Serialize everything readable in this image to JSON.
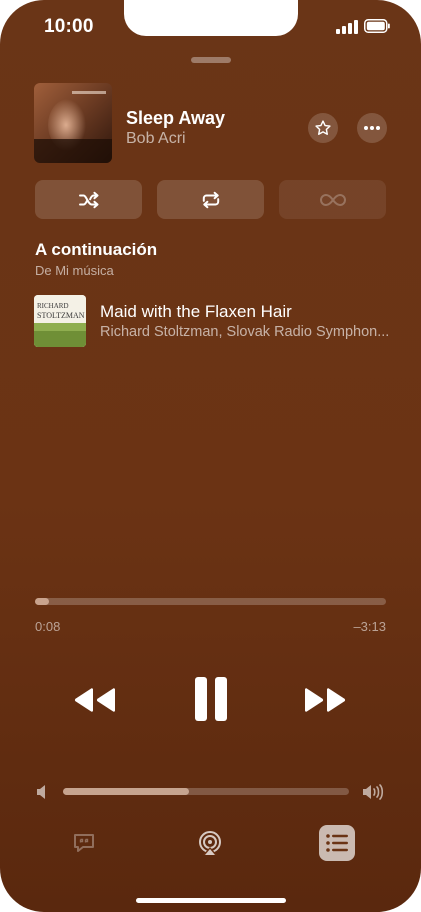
{
  "status_bar": {
    "time": "10:00"
  },
  "now_playing": {
    "title": "Sleep Away",
    "artist": "Bob Acri",
    "favorite_icon": "star-icon",
    "more_icon": "ellipsis-icon"
  },
  "modes": {
    "shuffle_icon": "shuffle-icon",
    "repeat_icon": "repeat-icon",
    "autoplay_icon": "infinity-icon"
  },
  "up_next": {
    "heading": "A continuación",
    "source": "De Mi música",
    "items": [
      {
        "title": "Maid with the Flaxen Hair",
        "artist": "Richard Stoltzman, Slovak Radio Symphon...",
        "art_text_line1": "RICHARD",
        "art_text_line2": "STOLTZMAN"
      }
    ]
  },
  "playback": {
    "elapsed": "0:08",
    "remaining": "–3:13",
    "progress_fraction": 0.04
  },
  "volume": {
    "level_fraction": 0.44
  },
  "bottom_bar": {
    "lyrics_icon": "lyrics-icon",
    "airplay_icon": "airplay-icon",
    "queue_icon": "queue-list-icon"
  },
  "colors": {
    "background": "#6a3517",
    "text_primary": "#ffffff",
    "queue_active": "#e8cdbd"
  }
}
